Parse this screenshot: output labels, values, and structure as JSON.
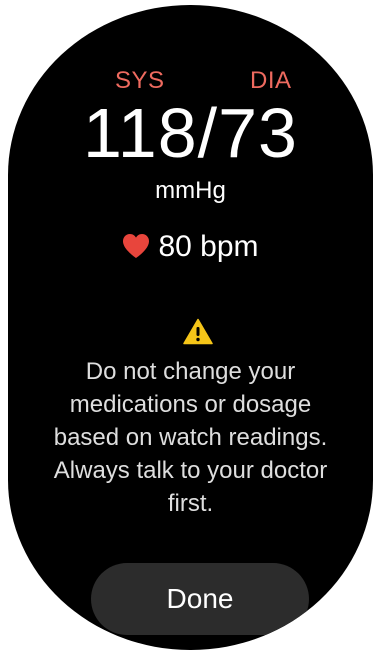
{
  "bp": {
    "sys_label": "SYS",
    "dia_label": "DIA",
    "reading": "118/73",
    "unit": "mmHg"
  },
  "pulse": {
    "value_text": "80 bpm",
    "icon": "heart-icon"
  },
  "warning": {
    "icon": "warning-icon",
    "text": "Do not change your medications or dosage based on watch readings. Always talk to your doctor first."
  },
  "actions": {
    "done_label": "Done"
  },
  "colors": {
    "background": "#000000",
    "label_accent": "#ee6a5f",
    "heart": "#e8453c",
    "warning_yellow": "#f5c518",
    "button_bg": "#2c2c2c",
    "text": "#ffffff"
  }
}
